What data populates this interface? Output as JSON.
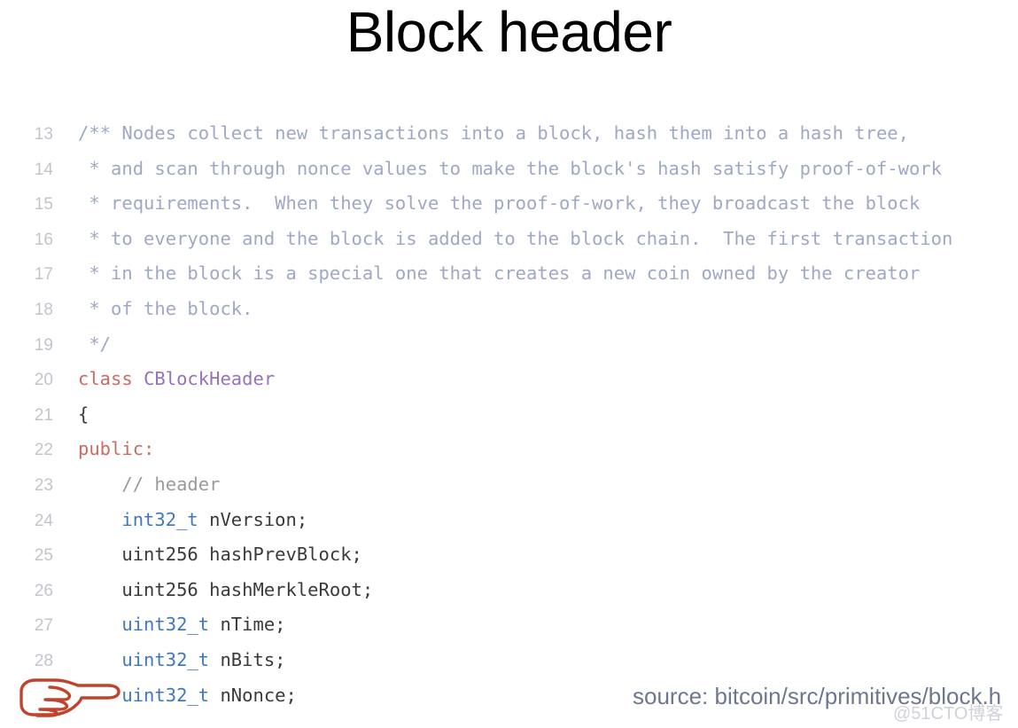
{
  "slide": {
    "title": "Block header",
    "background_color": "#ffffff"
  },
  "colors": {
    "title_text": "#000000",
    "line_number": "#c3c4cc",
    "block_comment": "#9fa8c4",
    "line_comment": "#9a9a9a",
    "keyword": "#cc6a63",
    "class_name": "#9571bf",
    "type": "#4078c0",
    "plain_code": "#3a3a3a",
    "pointer_hand": "#c0442c",
    "source_caption": "#6e7790",
    "watermark": "#cfd2d9"
  },
  "code": {
    "language": "cpp",
    "lines": [
      {
        "number": "13",
        "tokens": [
          {
            "text": "/** Nodes collect new transactions into a block, hash them into a hash tree,",
            "type": "comment"
          }
        ]
      },
      {
        "number": "14",
        "tokens": [
          {
            "text": " * and scan through nonce values to make the block's hash satisfy proof-of-work",
            "type": "comment"
          }
        ]
      },
      {
        "number": "15",
        "tokens": [
          {
            "text": " * requirements.  When they solve the proof-of-work, they broadcast the block",
            "type": "comment"
          }
        ]
      },
      {
        "number": "16",
        "tokens": [
          {
            "text": " * to everyone and the block is added to the block chain.  The first transaction",
            "type": "comment"
          }
        ]
      },
      {
        "number": "17",
        "tokens": [
          {
            "text": " * in the block is a special one that creates a new coin owned by the creator",
            "type": "comment"
          }
        ]
      },
      {
        "number": "18",
        "tokens": [
          {
            "text": " * of the block.",
            "type": "comment"
          }
        ]
      },
      {
        "number": "19",
        "tokens": [
          {
            "text": " */",
            "type": "comment"
          }
        ]
      },
      {
        "number": "20",
        "tokens": [
          {
            "text": "class ",
            "type": "keyword"
          },
          {
            "text": "CBlockHeader",
            "type": "classname"
          }
        ]
      },
      {
        "number": "21",
        "tokens": [
          {
            "text": "{",
            "type": "plain"
          }
        ]
      },
      {
        "number": "22",
        "tokens": [
          {
            "text": "public:",
            "type": "keyword"
          }
        ]
      },
      {
        "number": "23",
        "tokens": [
          {
            "text": "    // header",
            "type": "linecomment"
          }
        ]
      },
      {
        "number": "24",
        "tokens": [
          {
            "text": "    ",
            "type": "plain"
          },
          {
            "text": "int32_t",
            "type": "type"
          },
          {
            "text": " nVersion;",
            "type": "plain"
          }
        ]
      },
      {
        "number": "25",
        "tokens": [
          {
            "text": "    uint256 hashPrevBlock;",
            "type": "plain"
          }
        ]
      },
      {
        "number": "26",
        "tokens": [
          {
            "text": "    uint256 hashMerkleRoot;",
            "type": "plain"
          }
        ]
      },
      {
        "number": "27",
        "tokens": [
          {
            "text": "    ",
            "type": "plain"
          },
          {
            "text": "uint32_t",
            "type": "type"
          },
          {
            "text": " nTime;",
            "type": "plain"
          }
        ]
      },
      {
        "number": "28",
        "tokens": [
          {
            "text": "    ",
            "type": "plain"
          },
          {
            "text": "uint32_t",
            "type": "type"
          },
          {
            "text": " nBits;",
            "type": "plain"
          }
        ]
      },
      {
        "number": "",
        "tokens": [
          {
            "text": "    ",
            "type": "plain"
          },
          {
            "text": "uint32_t",
            "type": "type"
          },
          {
            "text": " nNonce;",
            "type": "plain"
          }
        ]
      }
    ]
  },
  "annotation": {
    "pointer_icon": "pointing-hand-right-icon"
  },
  "source": {
    "caption": "source: bitcoin/src/primitives/block.h"
  },
  "watermark": {
    "text": "@51CTO博客"
  }
}
